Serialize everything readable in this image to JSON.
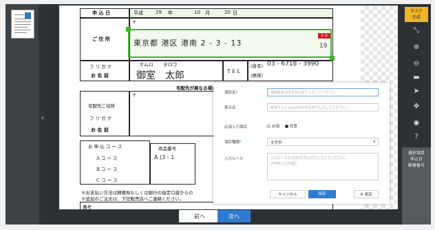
{
  "task_button": {
    "line1": "タスク",
    "line2": "作成"
  },
  "nav": {
    "prev": "前へ",
    "next": "次へ"
  },
  "info_panel": [
    "選択項目",
    "申込日",
    "郵便番号"
  ],
  "form": {
    "date_label": "申 込 日",
    "date_era": "平成",
    "date_year": "29",
    "date_year_unit": "年",
    "date_month": "10",
    "date_month_unit": "月",
    "date_day": "20",
    "date_day_unit": "日",
    "address_label": "ご 住 所",
    "postal_mark": "〒",
    "address_value": "東京都 港区 港南 2 - 3 - 13",
    "badge_top": "1-3",
    "badge_side": "19",
    "furigana_label": "フ リ ガ ナ",
    "furigana_value": "オムロ　　タロウ",
    "name_label": "お 名 前",
    "name_value": "御室　太郎",
    "tel_label": "T E L",
    "tel_home": "(自宅)",
    "tel_number": "03 - 6718 - 3990",
    "tel_mobile": "(携帯)",
    "delivery_note": "宅配先が異なる場合は",
    "delivery_address_label": "宅配先ご住所",
    "delivery_postal": "〒",
    "delivery_furigana_label": "フ リ ガ ナ",
    "delivery_name_label": "お 名 前",
    "course_label": "お 申 込 コ ー ス",
    "product_label": "商品番号",
    "course_a": "A コ ー ス",
    "course_a_value": "A (3 - 1",
    "course_b": "B コ ー ス",
    "course_c": "C コ ー ス",
    "footnote1": "※お支払い方法は郵便局もしくは銀行の指定口座からの",
    "footnote2": "※追加のご注文は、下記販売店へご連絡ください。",
    "remarks_label": "備考"
  },
  "modal": {
    "item_name_label": "項目名",
    "item_name_placeholder": "項目名を255文字以内で入力してください。",
    "display_name_label": "表示名",
    "display_name_placeholder": "帳票タイトルは255文字以内で入力してください。",
    "required_label": "必須入力項目",
    "required_options": [
      "必須",
      "任意"
    ],
    "required_selected": "任意",
    "type_label": "項目種類",
    "type_value": "文字列",
    "rule_label": "入力ルール",
    "rule_placeholder_1": "入力ルールを1000文字以内で入力してください。",
    "rule_placeholder_2": "(HTML入力可能)",
    "cancel_button": "キャンセル",
    "save_button": "保存",
    "settings_button": "設定"
  }
}
